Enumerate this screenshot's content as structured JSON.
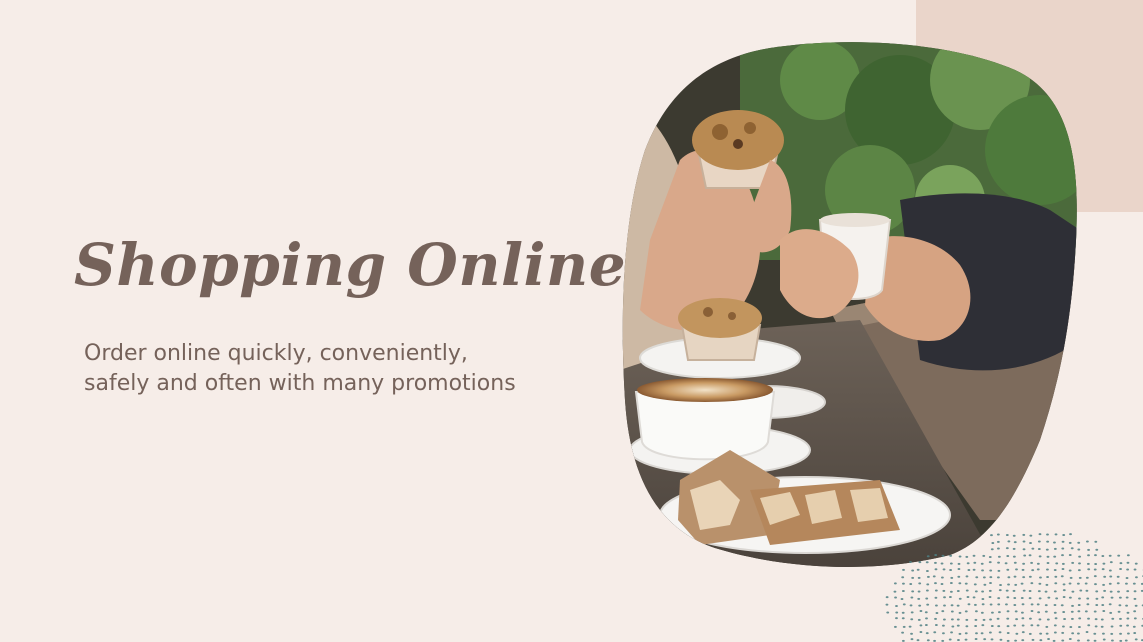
{
  "slide": {
    "title": "Shopping Online",
    "subtitle": "Order online quickly, conveniently, safely and often with many promotions"
  },
  "colors": {
    "background": "#f6ede8",
    "accent_blob": "#ead5ca",
    "text": "#75625a",
    "dots": "#4f7f82"
  },
  "image": {
    "subject": "people having coffee and muffins at a cafe table"
  }
}
